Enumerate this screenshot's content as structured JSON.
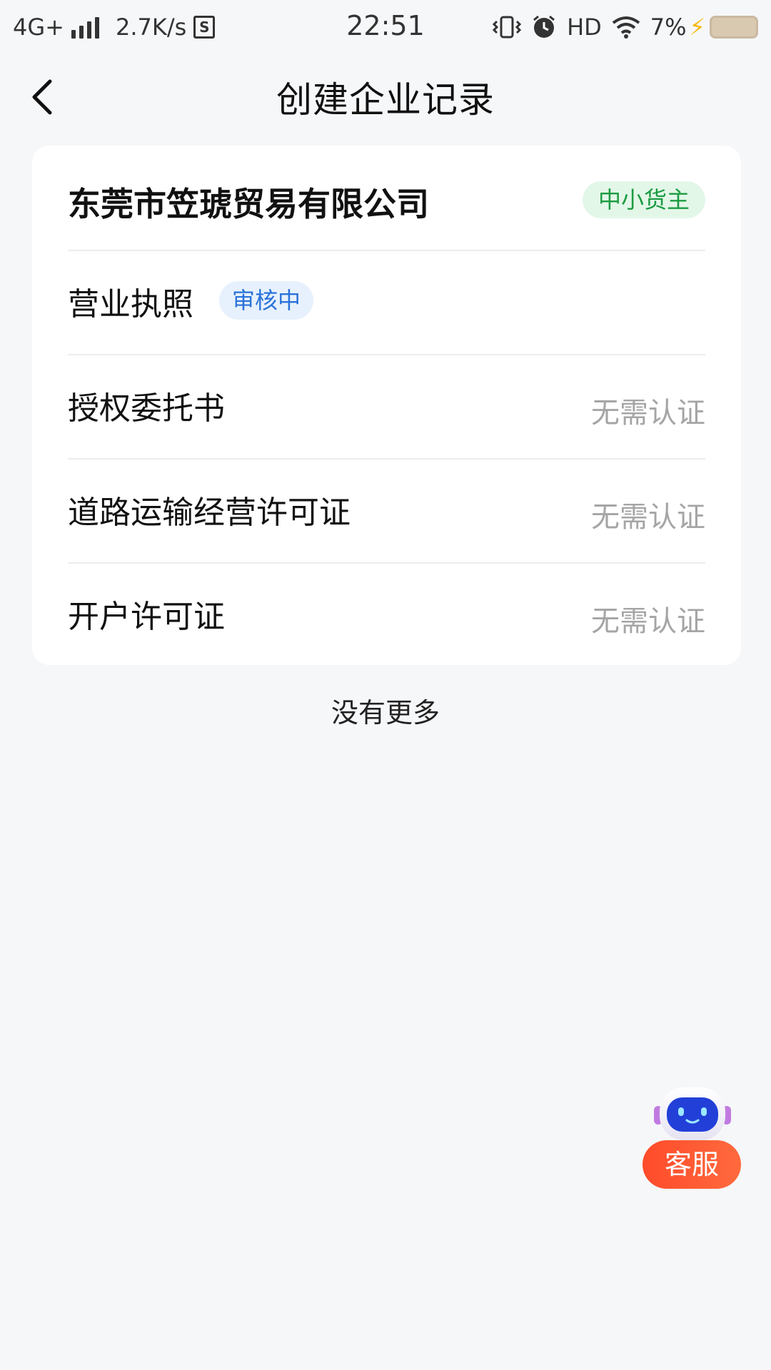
{
  "status_bar": {
    "network": "4G+",
    "speed": "2.7K/s",
    "s_label": "S",
    "time": "22:51",
    "hd": "HD",
    "battery": "7%"
  },
  "nav": {
    "title": "创建企业记录"
  },
  "company": {
    "name": "东莞市笠琥贸易有限公司",
    "role_badge": "中小货主"
  },
  "records": [
    {
      "label": "营业执照",
      "badge": "审核中",
      "status": ""
    },
    {
      "label": "授权委托书",
      "badge": "",
      "status": "无需认证"
    },
    {
      "label": "道路运输经营许可证",
      "badge": "",
      "status": "无需认证"
    },
    {
      "label": "开户许可证",
      "badge": "",
      "status": "无需认证"
    }
  ],
  "footer": {
    "no_more": "没有更多"
  },
  "service": {
    "label": "客服"
  },
  "colors": {
    "accent_green": "#1c9b41",
    "accent_blue": "#2a72d8",
    "service_red": "#ff4b2b"
  }
}
